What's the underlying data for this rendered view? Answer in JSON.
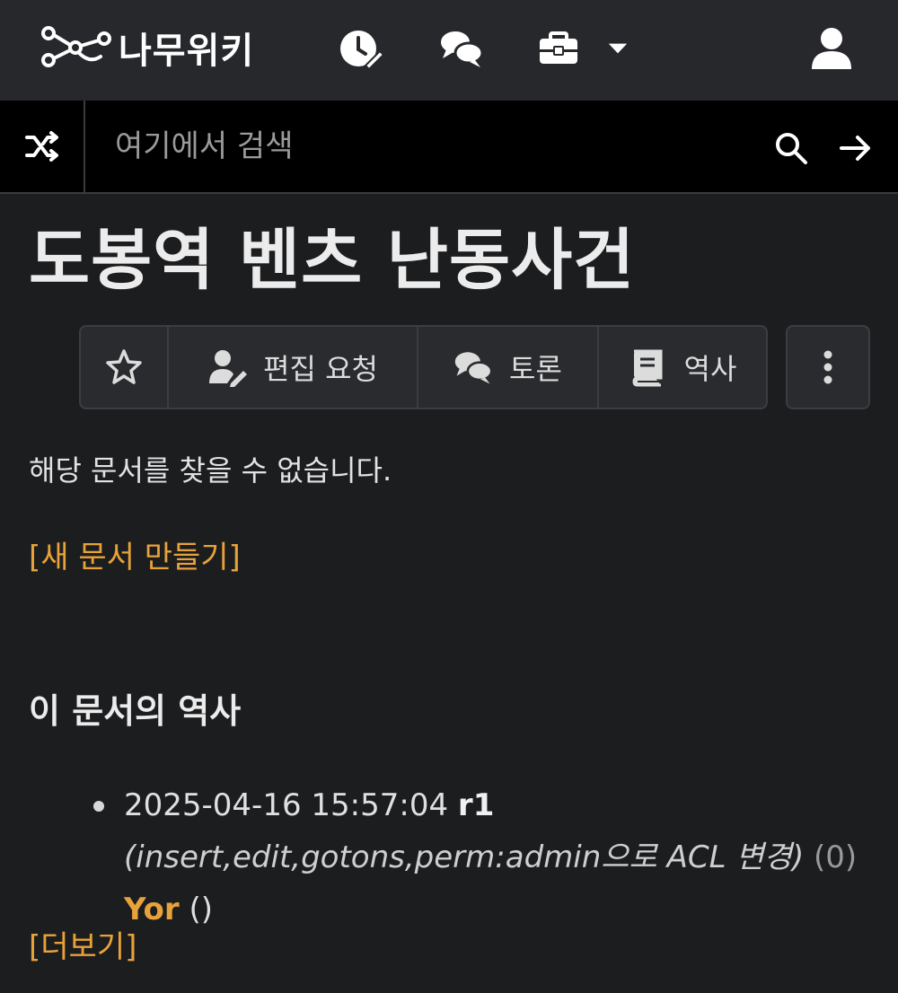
{
  "header": {
    "logo_text": "나무위키",
    "icons": [
      "recent-changes-icon",
      "discussion-icon",
      "tools-icon",
      "caret-down-icon",
      "user-icon"
    ]
  },
  "search": {
    "placeholder": "여기에서 검색"
  },
  "page": {
    "title": "도봉역 벤츠 난동사건"
  },
  "toolbar": {
    "edit_request_label": "편집 요청",
    "discuss_label": "토론",
    "history_label": "역사"
  },
  "content": {
    "not_found_text": "해당 문서를 찾을 수 없습니다.",
    "create_link": "[새 문서 만들기]"
  },
  "history": {
    "heading": "이 문서의 역사",
    "items": [
      {
        "datetime": "2025-04-16 15:57:04",
        "revision": "r1",
        "log": "(insert,edit,gotons,perm:admin으로 ACL 변경)",
        "diff": "(0)",
        "author": "Yor",
        "extra": "()"
      }
    ],
    "more_link": "[더보기]"
  },
  "colors": {
    "link": "#e8a23a",
    "topbar": "#27282b",
    "background": "#1c1d1f"
  }
}
